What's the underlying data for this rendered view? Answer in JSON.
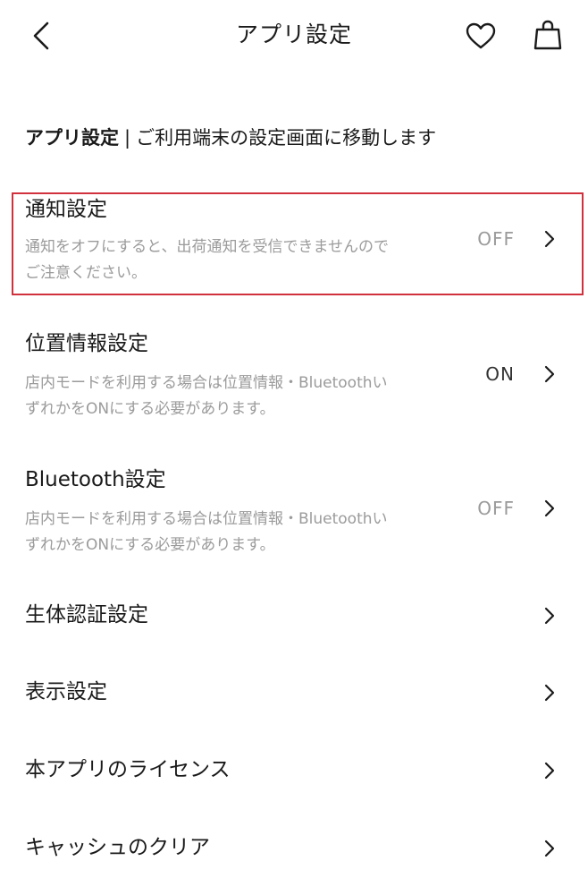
{
  "header": {
    "title": "アプリ設定",
    "back_icon": "chevron-left-icon",
    "favorite_icon": "heart-icon",
    "bag_icon": "shopping-bag-icon"
  },
  "section": {
    "title": "アプリ設定",
    "separator": "|",
    "description": "ご利用端末の設定画面に移動します"
  },
  "items": [
    {
      "title": "通知設定",
      "desc_line1": "通知をオフにすると、出荷通知を受信できませんので",
      "desc_line2": "ご注意ください。",
      "status": "OFF"
    },
    {
      "title": "位置情報設定",
      "desc_line1": "店内モードを利用する場合は位置情報・Bluetoothい",
      "desc_line2": "ずれかをONにする必要があります。",
      "status": "ON"
    },
    {
      "title": "Bluetooth設定",
      "desc_line1": "店内モードを利用する場合は位置情報・Bluetoothい",
      "desc_line2": "ずれかをONにする必要があります。",
      "status": "OFF"
    },
    {
      "title": "生体認証設定"
    },
    {
      "title": "表示設定"
    },
    {
      "title": "本アプリのライセンス"
    },
    {
      "title": "キャッシュのクリア"
    }
  ],
  "colors": {
    "highlight": "#d0313d",
    "muted_text": "#9b9b9b",
    "text": "#1a1a1a"
  }
}
